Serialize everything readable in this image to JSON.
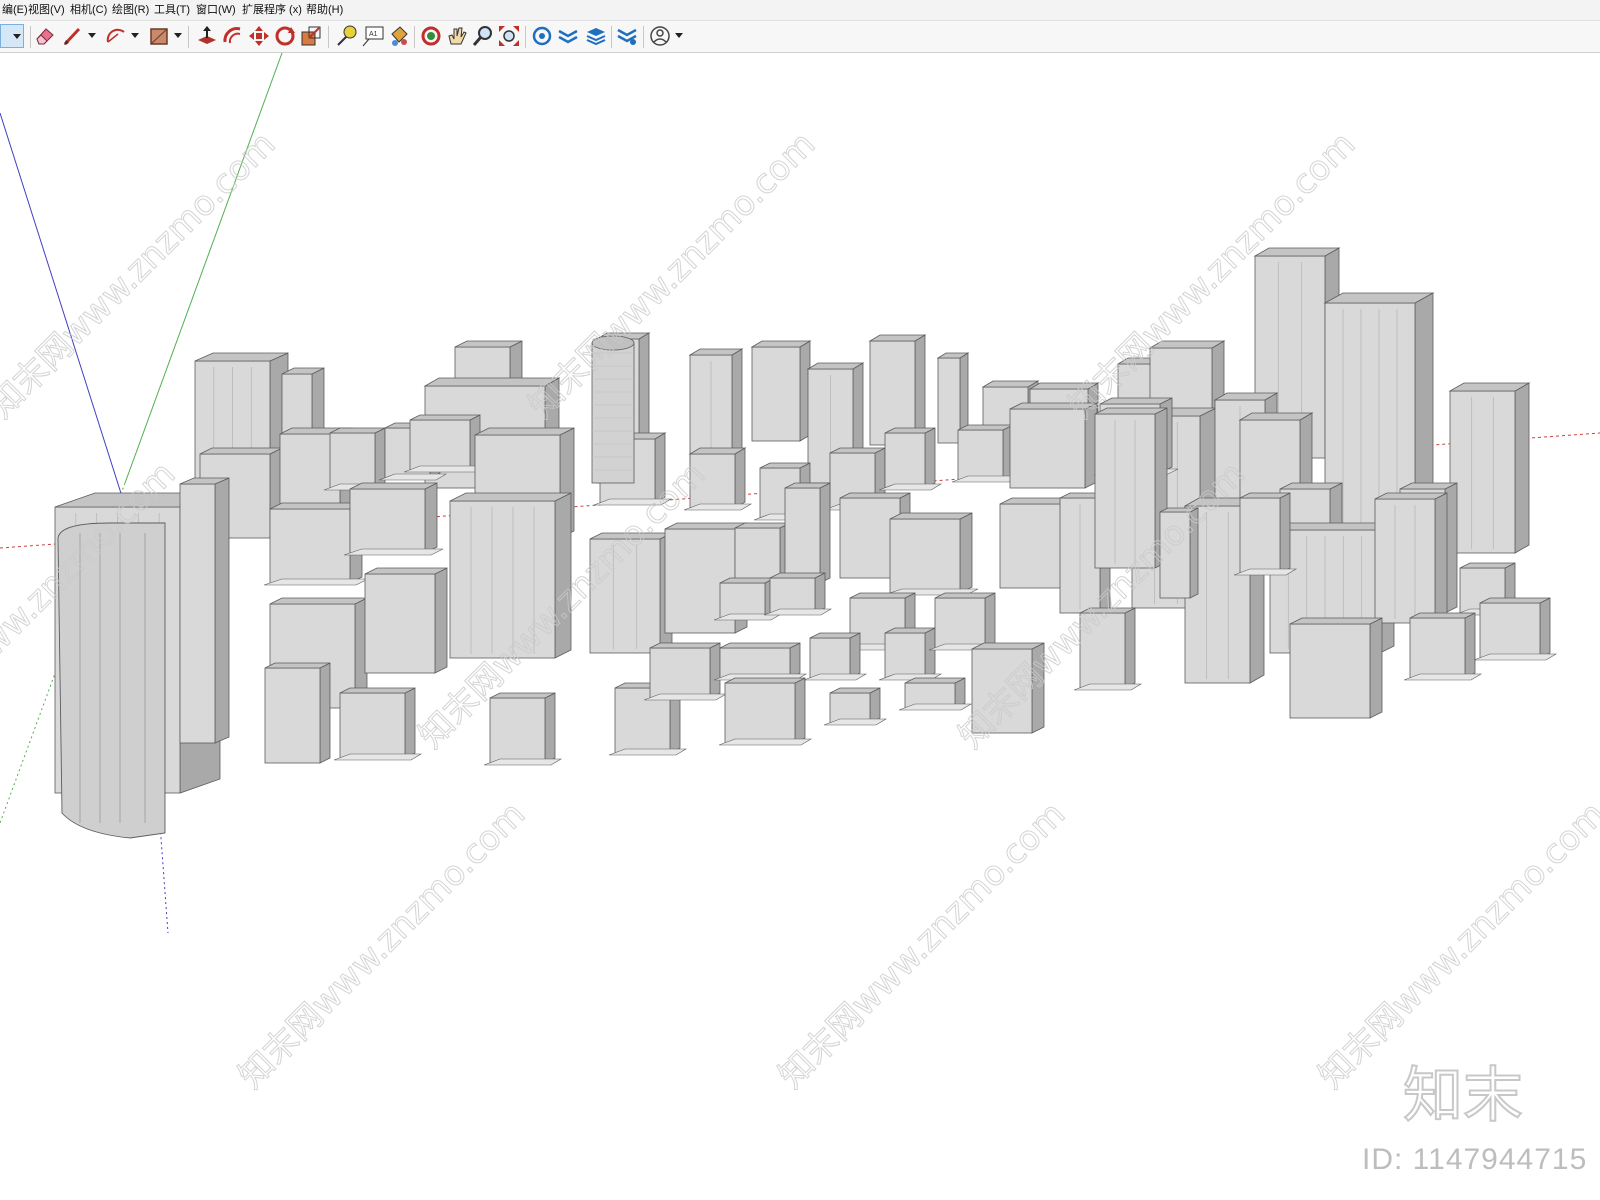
{
  "menu": {
    "items": [
      "编(E)",
      "视图(V)",
      "相机(C)",
      "绘图(R)",
      "工具(T)",
      "窗口(W)",
      "扩展程序 (x)",
      "帮助(H)"
    ]
  },
  "toolbar": {
    "tools": [
      {
        "name": "select-tool",
        "icon": "arrow-icon"
      },
      {
        "name": "eraser-tool",
        "icon": "eraser-icon"
      },
      {
        "name": "line-tool",
        "icon": "pencil-icon"
      },
      {
        "name": "arc-tool",
        "icon": "arc-icon"
      },
      {
        "name": "shape-tool",
        "icon": "rectangle-icon"
      },
      {
        "name": "push-pull-tool",
        "icon": "push-pull-icon"
      },
      {
        "name": "offset-tool",
        "icon": "offset-icon"
      },
      {
        "name": "move-tool",
        "icon": "move-icon"
      },
      {
        "name": "rotate-tool",
        "icon": "rotate-icon"
      },
      {
        "name": "scale-tool",
        "icon": "scale-icon"
      },
      {
        "name": "tape-measure-tool",
        "icon": "tape-measure-icon"
      },
      {
        "name": "text-tool",
        "icon": "text-icon"
      },
      {
        "name": "paint-bucket-tool",
        "icon": "paint-bucket-icon"
      },
      {
        "name": "orbit-tool",
        "icon": "orbit-icon"
      },
      {
        "name": "pan-tool",
        "icon": "hand-icon"
      },
      {
        "name": "zoom-tool",
        "icon": "magnifier-icon"
      },
      {
        "name": "zoom-extents-tool",
        "icon": "zoom-extents-icon"
      },
      {
        "name": "warehouse-tool",
        "icon": "warehouse-icon"
      },
      {
        "name": "extension-warehouse-tool",
        "icon": "extension-icon"
      },
      {
        "name": "layout-tool",
        "icon": "layers-icon"
      },
      {
        "name": "extension-manager-tool",
        "icon": "extension-manager-icon"
      },
      {
        "name": "account-tool",
        "icon": "user-icon"
      }
    ],
    "text_tool_label": "A1"
  },
  "watermark": {
    "text": "知末网www.znzmo.com",
    "logo_text": "知末",
    "id_text": "ID: 1147944715"
  },
  "colors": {
    "building_light": "#d9d9d9",
    "building_mid": "#c4c4c4",
    "building_dark": "#a9a9a9",
    "edge": "#5c5c5c",
    "axis_red": "#d04040",
    "axis_green": "#50b050",
    "axis_blue": "#4040c0"
  }
}
